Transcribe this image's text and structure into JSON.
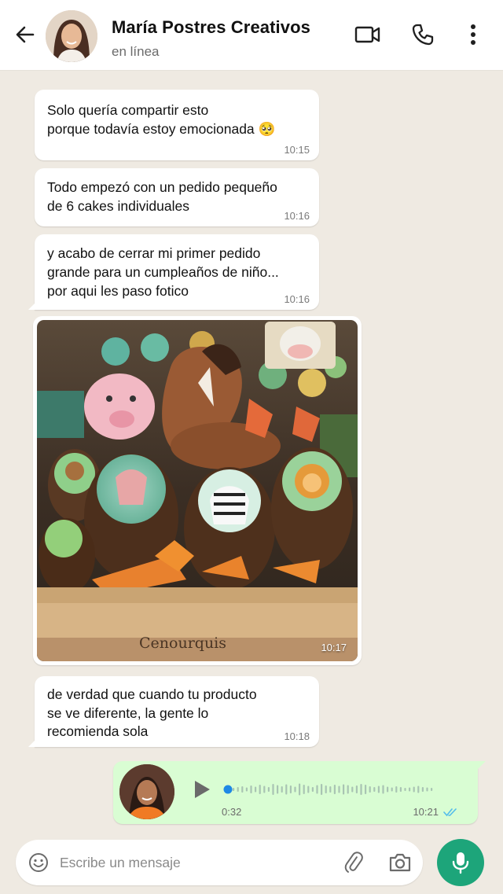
{
  "header": {
    "contact_name": "María Postres Creativos",
    "status": "en línea",
    "icons": [
      "back-arrow-icon",
      "video-call-icon",
      "phone-call-icon",
      "more-vert-icon"
    ]
  },
  "messages": [
    {
      "type": "text",
      "direction": "incoming",
      "text": "Solo quería compartir esto\nporque todavía estoy emocionada 🥺",
      "time": "10:15"
    },
    {
      "type": "text",
      "direction": "incoming",
      "text": "Todo empezó con un pedido pequeño\nde 6 cakes individuales",
      "time": "10:16"
    },
    {
      "type": "text",
      "direction": "incoming",
      "text": "y acabo de cerrar mi primer pedido\ngrande para un cumpleaños de niño...\npor aqui les paso fotico",
      "time": "10:16"
    },
    {
      "type": "image",
      "direction": "incoming",
      "crate_text": "Cenourquis",
      "time": "10:17"
    },
    {
      "type": "text",
      "direction": "incoming",
      "text": "de verdad que cuando tu producto\nse ve diferente, la gente lo\nrecomienda sola",
      "time": "10:18"
    },
    {
      "type": "voice",
      "direction": "outgoing",
      "duration": "0:32",
      "time": "10:21",
      "status": "read",
      "progress": 0
    }
  ],
  "composer": {
    "placeholder": "Escribe un mensaje",
    "icons": [
      "emoji-icon",
      "attach-icon",
      "camera-icon",
      "mic-icon"
    ]
  },
  "colors": {
    "background": "#efeae2",
    "incoming_bubble": "#ffffff",
    "outgoing_bubble": "#d9fdd3",
    "accent": "#1da57a",
    "read_ticks": "#53bdeb",
    "voice_dot": "#1e88e5"
  }
}
